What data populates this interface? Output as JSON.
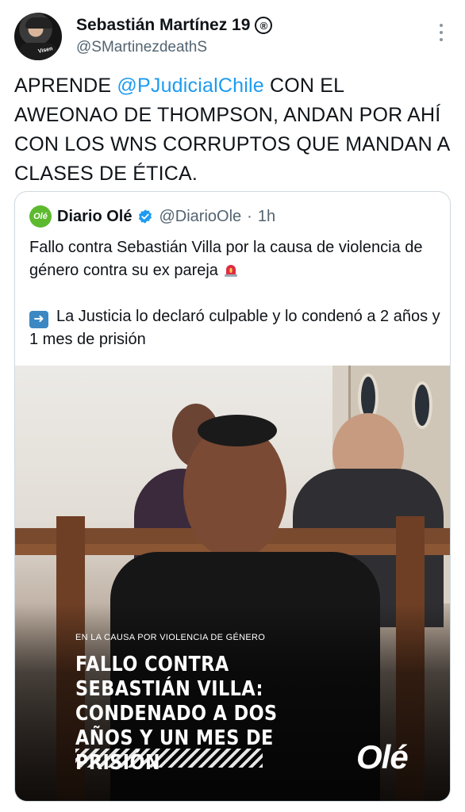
{
  "author": {
    "name": "Sebastián Martínez 19",
    "badge": "®",
    "handle": "@SMartinezdeathS",
    "avatar_label": "Visen"
  },
  "tweet": {
    "prefix": "APRENDE ",
    "mention": "@PJudicialChile",
    "suffix": " CON EL AWEONAO DE THOMPSON, ANDAN POR AHÍ CON LOS WNS CORRUPTOS QUE MANDAN A CLASES DE ÉTICA."
  },
  "quoted": {
    "logo_text": "Olé",
    "name": "Diario Olé",
    "handle": "@DiarioOle",
    "separator": "·",
    "time": "1h",
    "line1": "Fallo contra Sebastián Villa por la causa de violencia de género contra su ex pareja",
    "line2": "La Justicia lo declaró culpable y lo condenó a 2 años y 1 mes de prisión",
    "media": {
      "kicker": "EN LA CAUSA POR VIOLENCIA DE GÉNERO",
      "headline": "FALLO CONTRA SEBASTIÁN VILLA: CONDENADO A DOS AÑOS Y UN MES DE PRISIÓN",
      "brand": "Olé"
    }
  },
  "colors": {
    "link": "#1d9bf0",
    "secondary_text": "#536471",
    "verified": "#1d9bf0",
    "ole_green": "#5dba2f"
  },
  "icons": [
    "registered-icon",
    "more-options-icon",
    "verified-icon",
    "siren-icon",
    "right-arrow-icon"
  ]
}
